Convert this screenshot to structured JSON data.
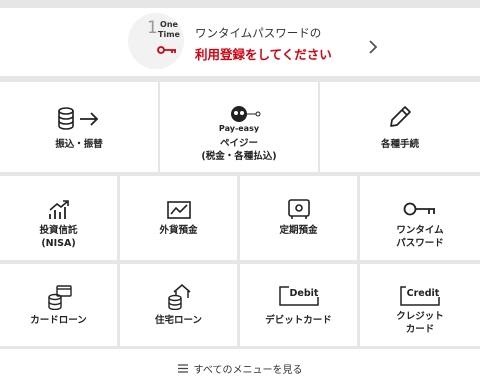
{
  "banner": {
    "badge_number": "1",
    "badge_text_1": "One",
    "badge_text_2": "Time",
    "line1": "ワンタイムパスワードの",
    "line2": "利用登録をしてください"
  },
  "tiles": [
    {
      "label": "振込・振替",
      "icon": "transfer-icon"
    },
    {
      "label": "ペイジー\n(税金・各種払込)",
      "icon": "payeasy-logo",
      "logo_text": "Pay-easy"
    },
    {
      "label": "各種手続",
      "icon": "pencil-icon"
    },
    {
      "label": "投資信託\n(NISA)",
      "icon": "investment-chart-icon"
    },
    {
      "label": "外貨預金",
      "icon": "fx-chart-icon"
    },
    {
      "label": "定期預金",
      "icon": "safe-icon"
    },
    {
      "label": "ワンタイム\nパスワード",
      "icon": "key-icon"
    },
    {
      "label": "カードローン",
      "icon": "card-loan-icon"
    },
    {
      "label": "住宅ローン",
      "icon": "home-loan-icon"
    },
    {
      "label": "デビットカード",
      "icon": "debit-card-icon",
      "card_text": "Debit"
    },
    {
      "label": "クレジット\nカード",
      "icon": "credit-card-icon",
      "card_text": "Credit"
    }
  ],
  "menu": {
    "label": "すべてのメニューを見る"
  },
  "colors": {
    "accent_red": "#d7000f",
    "background": "#e6e6e6"
  }
}
